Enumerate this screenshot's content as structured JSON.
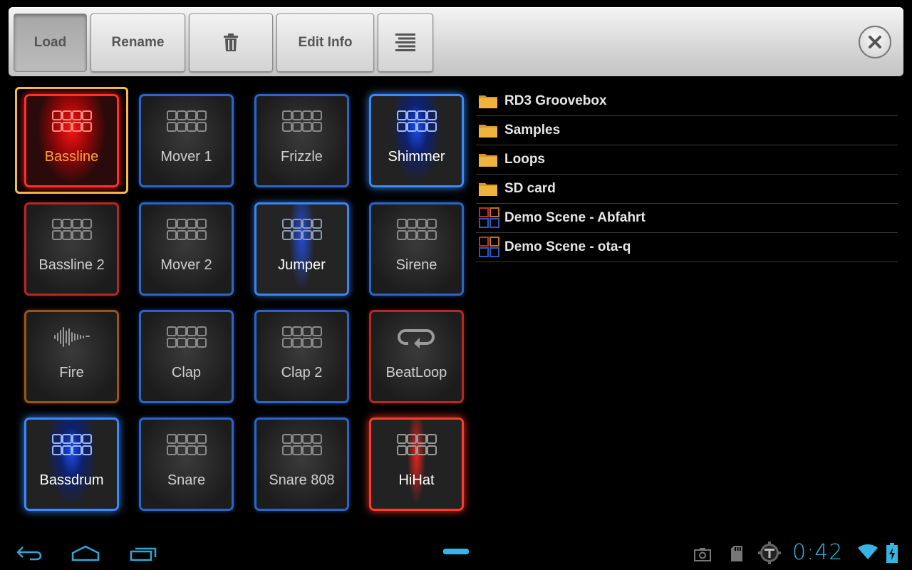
{
  "toolbar": {
    "load_label": "Load",
    "rename_label": "Rename",
    "edit_info_label": "Edit Info"
  },
  "pads": [
    {
      "label": "Bassline",
      "icon": "pattern-grid-icon",
      "color": "#ff3028"
    },
    {
      "label": "Mover 1",
      "icon": "pattern-grid-icon",
      "color": "#2a66c8"
    },
    {
      "label": "Frizzle",
      "icon": "pattern-grid-icon",
      "color": "#2a66c8"
    },
    {
      "label": "Shimmer",
      "icon": "pattern-grid-icon",
      "color": "#3a8aff"
    },
    {
      "label": "Bassline 2",
      "icon": "pattern-grid-icon",
      "color": "#b42a22"
    },
    {
      "label": "Mover 2",
      "icon": "pattern-grid-icon",
      "color": "#2a66c8"
    },
    {
      "label": "Jumper",
      "icon": "pattern-grid-icon",
      "color": "#3a86f0"
    },
    {
      "label": "Sirene",
      "icon": "pattern-grid-icon",
      "color": "#2a66c8"
    },
    {
      "label": "Fire",
      "icon": "waveform-icon",
      "color": "#9a5418"
    },
    {
      "label": "Clap",
      "icon": "pattern-grid-icon",
      "color": "#2a66c8"
    },
    {
      "label": "Clap 2",
      "icon": "pattern-grid-icon",
      "color": "#2a66c8"
    },
    {
      "label": "BeatLoop",
      "icon": "loop-icon",
      "color": "#b42a22"
    },
    {
      "label": "Bassdrum",
      "icon": "pattern-grid-icon",
      "color": "#3a8aff"
    },
    {
      "label": "Snare",
      "icon": "pattern-grid-icon",
      "color": "#2a66c8"
    },
    {
      "label": "Snare 808",
      "icon": "pattern-grid-icon",
      "color": "#2a66c8"
    },
    {
      "label": "HiHat",
      "icon": "pattern-grid-icon",
      "color": "#ff3a2a"
    }
  ],
  "files": [
    {
      "name": "RD3 Groovebox",
      "icon": "folder-icon"
    },
    {
      "name": "Samples",
      "icon": "folder-icon"
    },
    {
      "name": "Loops",
      "icon": "folder-icon"
    },
    {
      "name": "SD card",
      "icon": "folder-icon"
    },
    {
      "name": "Demo Scene - Abfahrt",
      "icon": "scene-icon"
    },
    {
      "name": "Demo Scene - ota-q",
      "icon": "scene-icon"
    }
  ],
  "system": {
    "clock": "0:42"
  },
  "colors": {
    "accent": "#35b5e5",
    "selection": "#f1c04a",
    "folder": "#f0b43c"
  }
}
